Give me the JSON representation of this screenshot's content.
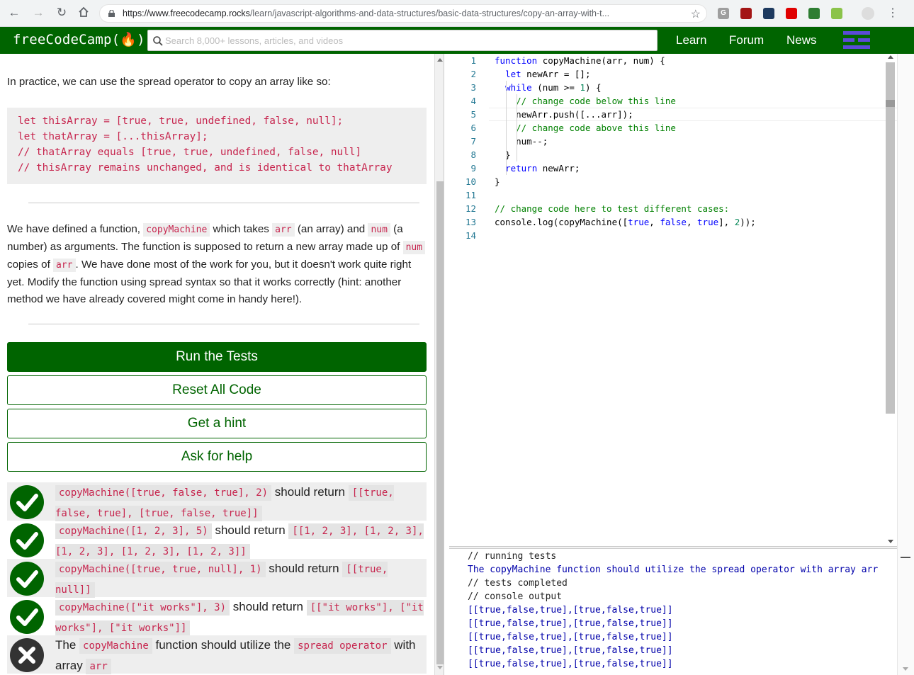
{
  "browser": {
    "url_domain": "https://www.freecodecamp.rocks",
    "url_path": "/learn/javascript-algorithms-and-data-structures/basic-data-structures/copy-an-array-with-t...",
    "extensions": [
      {
        "label": "G",
        "color": "#9e9e9e"
      },
      {
        "label": "",
        "color": "#a31515"
      },
      {
        "label": "",
        "color": "#1e3a5f"
      },
      {
        "label": "",
        "color": "#e00000"
      },
      {
        "label": "",
        "color": "#2e7d32"
      },
      {
        "label": "",
        "color": "#8bc34a"
      }
    ]
  },
  "nav": {
    "logo": "freeCodeCamp(🔥)",
    "search_placeholder": "Search 8,000+ lessons, articles, and videos",
    "links": [
      "Learn",
      "Forum",
      "News"
    ]
  },
  "lesson": {
    "intro": "In practice, we can use the spread operator to copy an array like so:",
    "example_code": [
      "let thisArray = [true, true, undefined, false, null];",
      "let thatArray = [...thisArray];",
      "// thatArray equals [true, true, undefined, false, null]",
      "// thisArray remains unchanged, and is identical to thatArray"
    ],
    "task": {
      "t1": "We have defined a function, ",
      "c1": "copyMachine",
      "t2": " which takes ",
      "c2": "arr",
      "t3": " (an array) and ",
      "c3": "num",
      "t4": " (a number) as arguments. The function is supposed to return a new array made up of ",
      "c4": "num",
      "t5": " copies of ",
      "c5": "arr",
      "t6": ". We have done most of the work for you, but it doesn't work quite right yet. Modify the function using spread syntax so that it works correctly (hint: another method we have already covered might come in handy here!)."
    }
  },
  "buttons": {
    "run": "Run the Tests",
    "reset": "Reset All Code",
    "hint": "Get a hint",
    "help": "Ask for help"
  },
  "tests": [
    {
      "status": "pass",
      "code": "copyMachine([true, false, true], 2)",
      "mid": " should return ",
      "result": "[[true, false, true], [true, false, true]]"
    },
    {
      "status": "pass",
      "code": "copyMachine([1, 2, 3], 5)",
      "mid": " should return ",
      "result": "[[1, 2, 3], [1, 2, 3], [1, 2, 3], [1, 2, 3], [1, 2, 3]]"
    },
    {
      "status": "pass",
      "code": "copyMachine([true, true, null], 1)",
      "mid": " should return ",
      "result": "[[true, null]]"
    },
    {
      "status": "pass",
      "code": "copyMachine([\"it works\"], 3)",
      "mid": " should return ",
      "result": "[[\"it works\"], [\"it works\"], [\"it works\"]]"
    },
    {
      "status": "fail",
      "pre": "The ",
      "code": "copyMachine",
      "mid": " function should utilize the ",
      "code2": "spread operator",
      "post": " with array ",
      "code3": "arr"
    }
  ],
  "editor": {
    "line_numbers": [
      "1",
      "2",
      "3",
      "4",
      "5",
      "6",
      "7",
      "8",
      "9",
      "10",
      "11",
      "12",
      "13",
      "14"
    ],
    "lines": [
      {
        "tokens": [
          {
            "t": "function",
            "c": "kw"
          },
          {
            "t": " copyMachine(arr, num) {",
            "c": ""
          }
        ]
      },
      {
        "tokens": [
          {
            "t": "  ",
            "c": ""
          },
          {
            "t": "let",
            "c": "kw"
          },
          {
            "t": " newArr = [];",
            "c": ""
          }
        ]
      },
      {
        "tokens": [
          {
            "t": "  ",
            "c": ""
          },
          {
            "t": "while",
            "c": "kw"
          },
          {
            "t": " (num >= ",
            "c": ""
          },
          {
            "t": "1",
            "c": "nm"
          },
          {
            "t": ") {",
            "c": ""
          }
        ]
      },
      {
        "tokens": [
          {
            "t": "    ",
            "c": ""
          },
          {
            "t": "// change code below this line",
            "c": "cm"
          }
        ]
      },
      {
        "tokens": [
          {
            "t": "    newArr.push([...arr]);",
            "c": ""
          }
        ]
      },
      {
        "tokens": [
          {
            "t": "    ",
            "c": ""
          },
          {
            "t": "// change code above this line",
            "c": "cm"
          }
        ]
      },
      {
        "tokens": [
          {
            "t": "    num--;",
            "c": ""
          }
        ]
      },
      {
        "tokens": [
          {
            "t": "  }",
            "c": ""
          }
        ]
      },
      {
        "tokens": [
          {
            "t": "  ",
            "c": ""
          },
          {
            "t": "return",
            "c": "kw"
          },
          {
            "t": " newArr;",
            "c": ""
          }
        ]
      },
      {
        "tokens": [
          {
            "t": "}",
            "c": ""
          }
        ]
      },
      {
        "tokens": []
      },
      {
        "tokens": [
          {
            "t": "// change code here to test different cases:",
            "c": "cm"
          }
        ]
      },
      {
        "tokens": [
          {
            "t": "console.log(copyMachine([",
            "c": ""
          },
          {
            "t": "true",
            "c": "kw"
          },
          {
            "t": ", ",
            "c": ""
          },
          {
            "t": "false",
            "c": "kw"
          },
          {
            "t": ", ",
            "c": ""
          },
          {
            "t": "true",
            "c": "kw"
          },
          {
            "t": "], ",
            "c": ""
          },
          {
            "t": "2",
            "c": "nm"
          },
          {
            "t": "));",
            "c": ""
          }
        ]
      },
      {
        "tokens": []
      }
    ]
  },
  "output": {
    "lines": [
      "// running tests",
      "The copyMachine function should utilize the spread operator with array arr",
      "// tests completed",
      "// console output",
      "[[true,false,true],[true,false,true]]",
      "[[true,false,true],[true,false,true]]",
      "[[true,false,true],[true,false,true]]",
      "[[true,false,true],[true,false,true]]",
      "[[true,false,true],[true,false,true]]"
    ]
  },
  "colors": {
    "brand": "#006400",
    "pass": "#006400",
    "fail": "#333333",
    "inline_code": "#c7254e"
  }
}
